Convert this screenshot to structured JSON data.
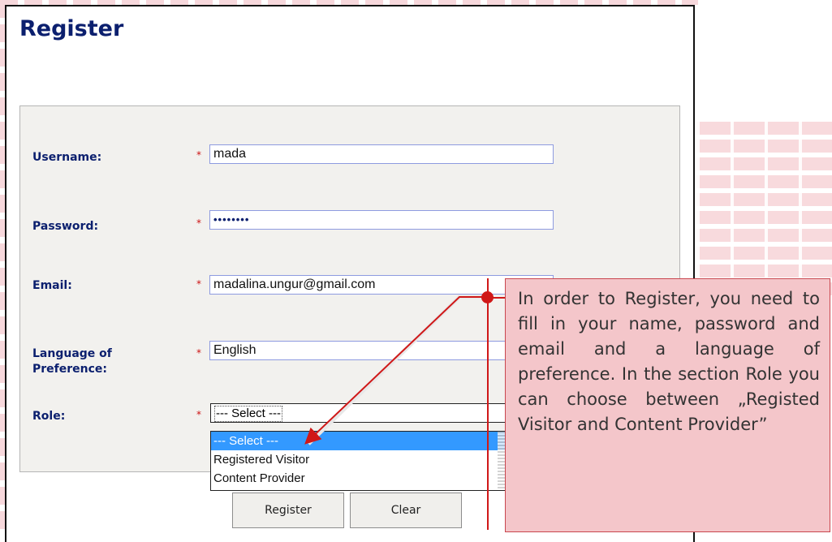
{
  "page": {
    "title": "Register"
  },
  "form": {
    "fields": [
      {
        "label": "Username:",
        "value": "mada",
        "required": true
      },
      {
        "label": "Password:",
        "value": "••••••••",
        "required": true
      },
      {
        "label": "Email:",
        "value": "madalina.ungur@gmail.com",
        "required": true
      },
      {
        "label": "Language of Preference:",
        "value": "English",
        "required": true
      },
      {
        "label": "Role:",
        "required": true
      }
    ],
    "required_marker": "*",
    "role": {
      "selected": "--- Select ---",
      "options": [
        "--- Select ---",
        "Registered Visitor",
        "Content Provider"
      ],
      "highlighted_option": "--- Select ---"
    },
    "buttons": {
      "register": "Register",
      "clear": "Clear"
    }
  },
  "callout": {
    "text": "In order to Register, you need to fill in your name, password and email and a language of preference. In the section Role you can choose between „Registed Visitor and Content Provider”"
  },
  "colors": {
    "title": "#0b1f6e",
    "required": "#cc1111",
    "callout_bg": "#f4c6ca",
    "callout_line": "#d01818",
    "selected_option": "#3399ff"
  }
}
